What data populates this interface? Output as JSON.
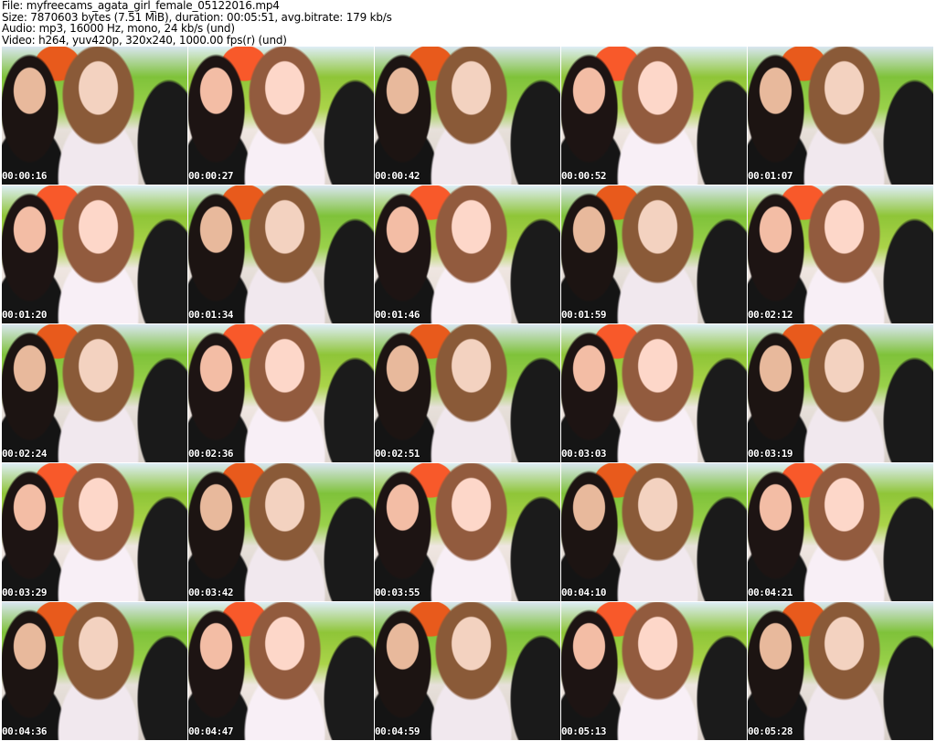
{
  "header": {
    "file": "File: myfreecams_agata_girl_female_05122016.mp4",
    "size": "Size: 7870603 bytes (7.51 MiB), duration: 00:05:51, avg.bitrate: 179 kb/s",
    "audio": "Audio: mp3, 16000 Hz, mono, 24 kb/s (und)",
    "video": "Video: h264, yuv420p, 320x240, 1000.00 fps(r) (und)"
  },
  "thumbnails": [
    "00:00:16",
    "00:00:27",
    "00:00:42",
    "00:00:52",
    "00:01:07",
    "00:01:20",
    "00:01:34",
    "00:01:46",
    "00:01:59",
    "00:02:12",
    "00:02:24",
    "00:02:36",
    "00:02:51",
    "00:03:03",
    "00:03:19",
    "00:03:29",
    "00:03:42",
    "00:03:55",
    "00:04:10",
    "00:04:21",
    "00:04:36",
    "00:04:47",
    "00:04:59",
    "00:05:13",
    "00:05:28"
  ]
}
